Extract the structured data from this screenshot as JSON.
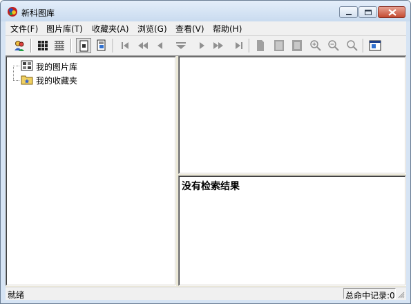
{
  "window": {
    "title": "新科图库"
  },
  "menu": [
    {
      "label": "文件(F)"
    },
    {
      "label": "图片库(T)"
    },
    {
      "label": "收藏夹(A)"
    },
    {
      "label": "浏览(G)"
    },
    {
      "label": "查看(V)"
    },
    {
      "label": "帮助(H)"
    }
  ],
  "toolbar": {
    "buttons": [
      {
        "icon": "users-icon"
      },
      {
        "icon": "thumbnails-icon"
      },
      {
        "icon": "details-list-icon"
      },
      {
        "icon": "single-page-icon"
      },
      {
        "icon": "page-properties-icon"
      },
      {
        "icon": "first-icon"
      },
      {
        "icon": "previous-fast-icon"
      },
      {
        "icon": "previous-icon"
      },
      {
        "icon": "down-icon"
      },
      {
        "icon": "next-icon"
      },
      {
        "icon": "next-fast-icon"
      },
      {
        "icon": "last-icon"
      },
      {
        "icon": "page-icon"
      },
      {
        "icon": "fit-page-icon"
      },
      {
        "icon": "actual-size-icon"
      },
      {
        "icon": "zoom-in-icon"
      },
      {
        "icon": "zoom-out-icon"
      },
      {
        "icon": "zoom-icon"
      },
      {
        "icon": "fullscreen-icon"
      }
    ]
  },
  "tree": {
    "items": [
      {
        "label": "我的图片库",
        "icon": "library-icon"
      },
      {
        "label": "我的收藏夹",
        "icon": "favorites-folder-icon"
      }
    ]
  },
  "results": {
    "empty_text": "没有检索结果"
  },
  "status": {
    "left": "就绪",
    "right": "总命中记录:0"
  },
  "colors": {
    "titlebar": "#c9dbef",
    "close_button": "#c44b33",
    "face": "#f0f0f0"
  }
}
